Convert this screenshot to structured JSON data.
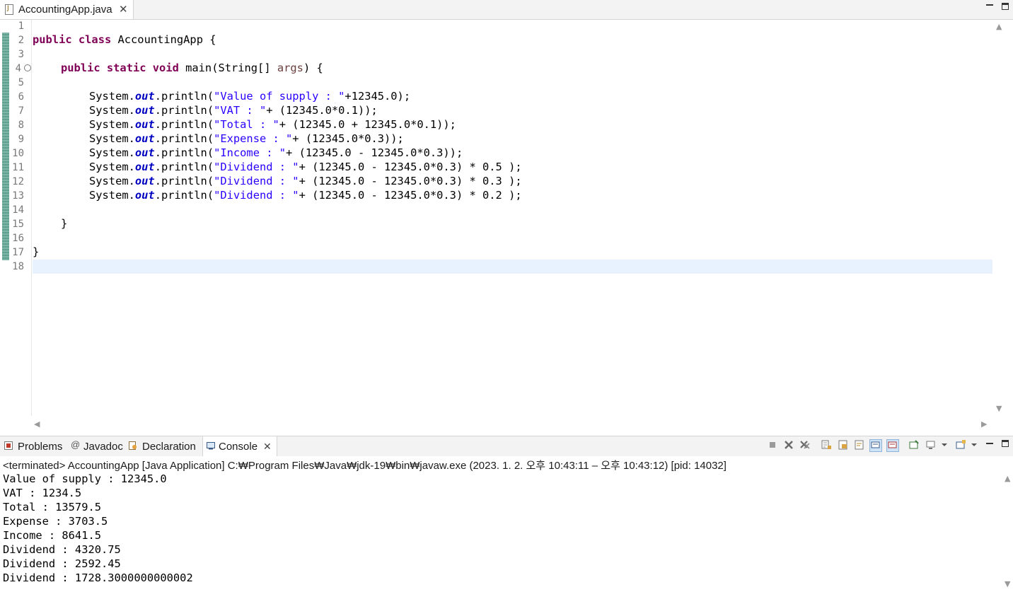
{
  "editor": {
    "tab_label": "AccountingApp.java",
    "close_glyph": "✕",
    "line_numbers": [
      "1",
      "2",
      "3",
      "4",
      "5",
      "6",
      "7",
      "8",
      "9",
      "10",
      "11",
      "12",
      "13",
      "14",
      "15",
      "16",
      "17",
      "18"
    ],
    "fold_glyph": "⊖",
    "code": {
      "l2_kw1": "public",
      "l2_kw2": "class",
      "l2_rest": " AccountingApp {",
      "l4_kw1": "public",
      "l4_kw2": "static",
      "l4_kw3": "void",
      "l4_mid": " main(String[] ",
      "l4_var": "args",
      "l4_end": ") {",
      "sys": "System.",
      "out": "out",
      "println": ".println(",
      "s6": "\"Value of supply : \"",
      "r6": "+12345.0);",
      "s7": "\"VAT : \"",
      "r7": "+ (12345.0*0.1));",
      "s8": "\"Total : \"",
      "r8": "+ (12345.0 + 12345.0*0.1));",
      "s9": "\"Expense : \"",
      "r9": "+ (12345.0*0.3));",
      "s10": "\"Income : \"",
      "r10": "+ (12345.0 - 12345.0*0.3));",
      "s11": "\"Dividend : \"",
      "r11": "+ (12345.0 - 12345.0*0.3) * 0.5 );",
      "s12": "\"Dividend : \"",
      "r12": "+ (12345.0 - 12345.0*0.3) * 0.3 );",
      "s13": "\"Dividend : \"",
      "r13": "+ (12345.0 - 12345.0*0.3) * 0.2 );",
      "l15": "}",
      "l17": "}"
    }
  },
  "panel": {
    "tabs": {
      "problems": "Problems",
      "javadoc": "Javadoc",
      "declaration": "Declaration",
      "console": "Console"
    },
    "close_glyph": "✕",
    "status": "<terminated> AccountingApp [Java Application] C:₩Program Files₩Java₩jdk-19₩bin₩javaw.exe  (2023. 1. 2. 오후 10:43:11 – 오후 10:43:12) [pid: 14032]",
    "output": [
      "Value of supply : 12345.0",
      "VAT : 1234.5",
      "Total : 13579.5",
      "Expense : 3703.5",
      "Income : 8641.5",
      "Dividend : 4320.75",
      "Dividend : 2592.45",
      "Dividend : 1728.3000000000002"
    ]
  },
  "icons": {
    "up": "▲",
    "down": "▼",
    "left": "◀",
    "right": "▶"
  },
  "colors": {
    "keyword": "#7f0055",
    "string": "#2a00ff",
    "field": "#0000c0",
    "current_line": "#e8f2fe"
  }
}
